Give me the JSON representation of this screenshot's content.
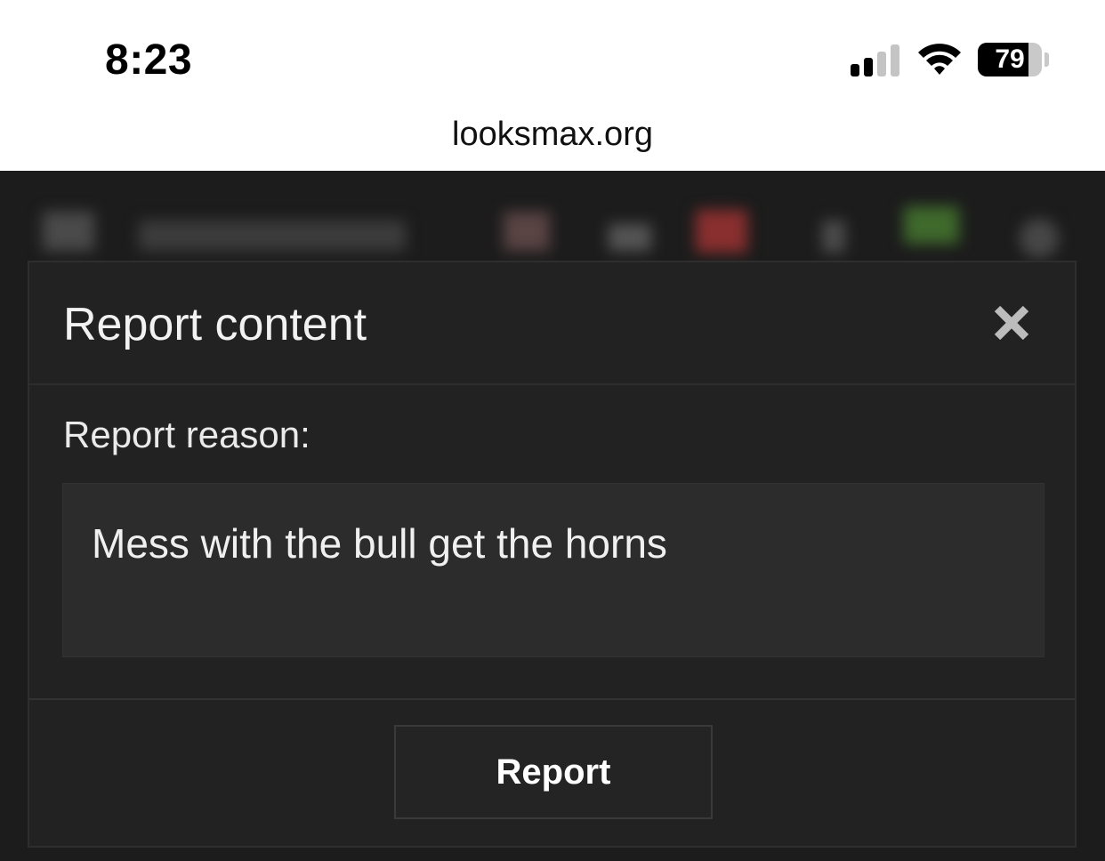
{
  "status_bar": {
    "time": "8:23",
    "battery_percent": 79,
    "battery_label": "79",
    "signal_bars_active": 2,
    "signal_bars_total": 4,
    "wifi_icon": "wifi-icon"
  },
  "browser": {
    "url": "looksmax.org"
  },
  "modal": {
    "title": "Report content",
    "close_icon": "close-icon",
    "reason_label": "Report reason:",
    "reason_value": "Mess with the bull get the horns",
    "submit_label": "Report"
  },
  "colors": {
    "modal_bg": "#222222",
    "input_bg": "#2c2c2c",
    "text": "#f2f2f2",
    "backdrop": "#1c1c1c"
  }
}
